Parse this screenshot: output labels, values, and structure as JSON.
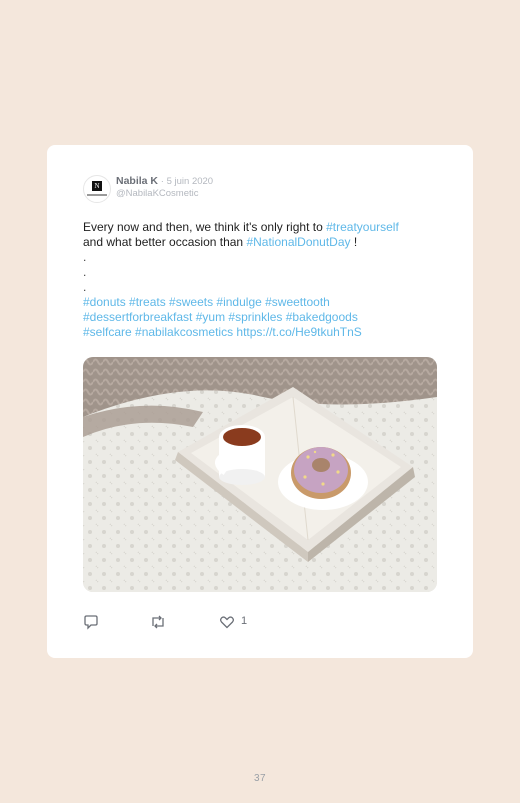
{
  "tweet": {
    "author_name": "Nabila K",
    "date": "· 5 juin 2020",
    "handle": "@NabilaKCosmetic",
    "avatar_logo_letter": "N",
    "text": {
      "line1_prefix": "Every now and then, we think it's only right to ",
      "line1_hashtag": "#treatyourself",
      "line2_prefix": "and what better occasion than ",
      "line2_hashtag": "#NationalDonutDay",
      "line2_suffix": " !",
      "dots": [
        ".",
        ".",
        "."
      ],
      "hashtags_line1": "#donuts #treats #sweets #indulge #sweettooth",
      "hashtags_line2": "#dessertforbreakfast #yum #sprinkles #bakedgoods",
      "hashtags_line3": "#selfcare #nabilakcosmetics https://t.co/He9tkuhTnS"
    },
    "likes": "1"
  },
  "footer": {
    "page_number": "37"
  },
  "colors": {
    "background": "#f4e7dc",
    "card": "#ffffff",
    "link": "#5fb8e8"
  },
  "icons": {
    "reply": "reply-icon",
    "retweet": "retweet-icon",
    "like": "heart-icon"
  }
}
